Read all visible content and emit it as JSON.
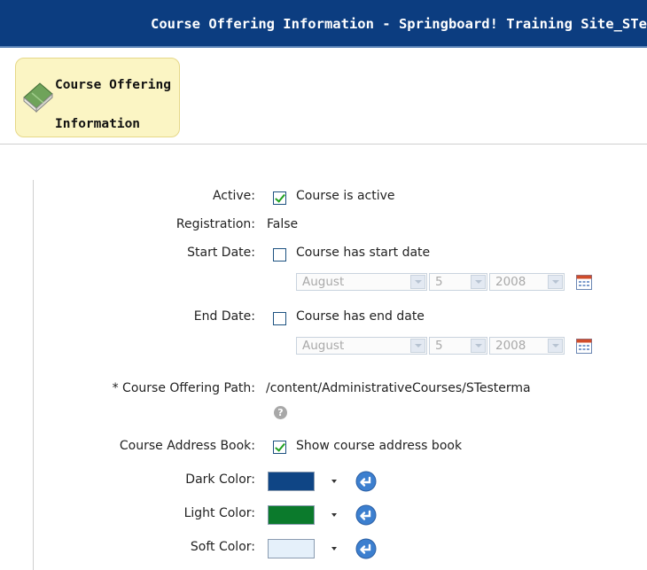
{
  "header": {
    "title": "Course Offering Information - Springboard! Training Site_STest"
  },
  "tab": {
    "label": "Course Offering Information",
    "icon": "book-icon"
  },
  "form": {
    "active": {
      "label": "Active:",
      "checkbox_label": "Course is active",
      "checked": true
    },
    "registration": {
      "label": "Registration:",
      "value": "False"
    },
    "start_date": {
      "label": "Start Date:",
      "checkbox_label": "Course has start date",
      "checked": false,
      "month": "August",
      "day": "5",
      "year": "2008"
    },
    "end_date": {
      "label": "End Date:",
      "checkbox_label": "Course has end date",
      "checked": false,
      "month": "August",
      "day": "5",
      "year": "2008"
    },
    "path": {
      "label": "* Course Offering Path:",
      "value": "/content/AdministrativeCourses/STesterma"
    },
    "address_book": {
      "label": "Course Address Book:",
      "checkbox_label": "Show course address book",
      "checked": true
    },
    "dark_color": {
      "label": "Dark Color:",
      "color": "#0f4585"
    },
    "light_color": {
      "label": "Light Color:",
      "color": "#0b7a2c"
    },
    "soft_color": {
      "label": "Soft Color:",
      "color": "#e5f0fa"
    }
  }
}
